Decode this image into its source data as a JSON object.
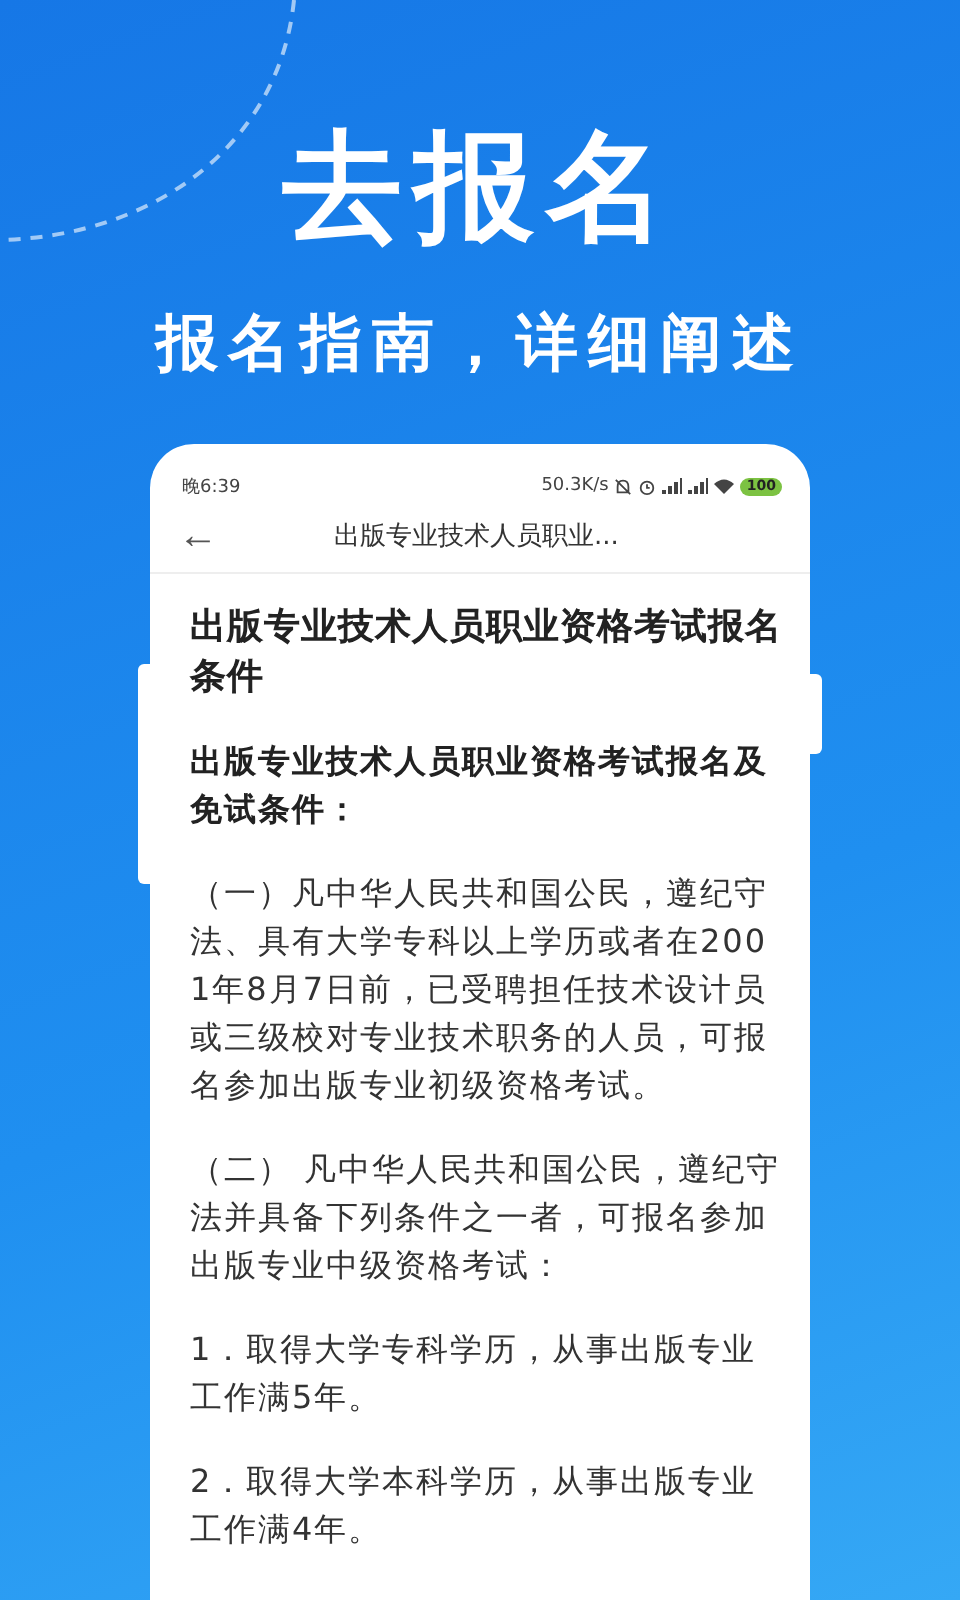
{
  "banner": {
    "headline": "去报名",
    "subtitle": "报名指南，详细阐述"
  },
  "status_bar": {
    "time": "晚6:39",
    "speed": "50.3K/s",
    "battery": "100"
  },
  "nav_bar": {
    "back": "←",
    "title": "出版专业技术人员职业..."
  },
  "article": {
    "title": "出版专业技术人员职业资格考试报名条件",
    "paragraphs": [
      {
        "kind": "bold",
        "text": "出版专业技术人员职业资格考试报名及免试条件："
      },
      {
        "kind": "plain",
        "text": "（一）凡中华人民共和国公民，遵纪守法、具有大学专科以上学历或者在2001年8月7日前，已受聘担任技术设计员或三级校对专业技术职务的人员，可报名参加出版专业初级资格考试。"
      },
      {
        "kind": "plain",
        "text": "（二） 凡中华人民共和国公民，遵纪守法并具备下列条件之一者，可报名参加出版专业中级资格考试："
      },
      {
        "kind": "plain",
        "text": "1．取得大学专科学历，从事出版专业工作满5年。"
      },
      {
        "kind": "plain",
        "text": "2．取得大学本科学历，从事出版专业工作满4年。"
      }
    ]
  }
}
